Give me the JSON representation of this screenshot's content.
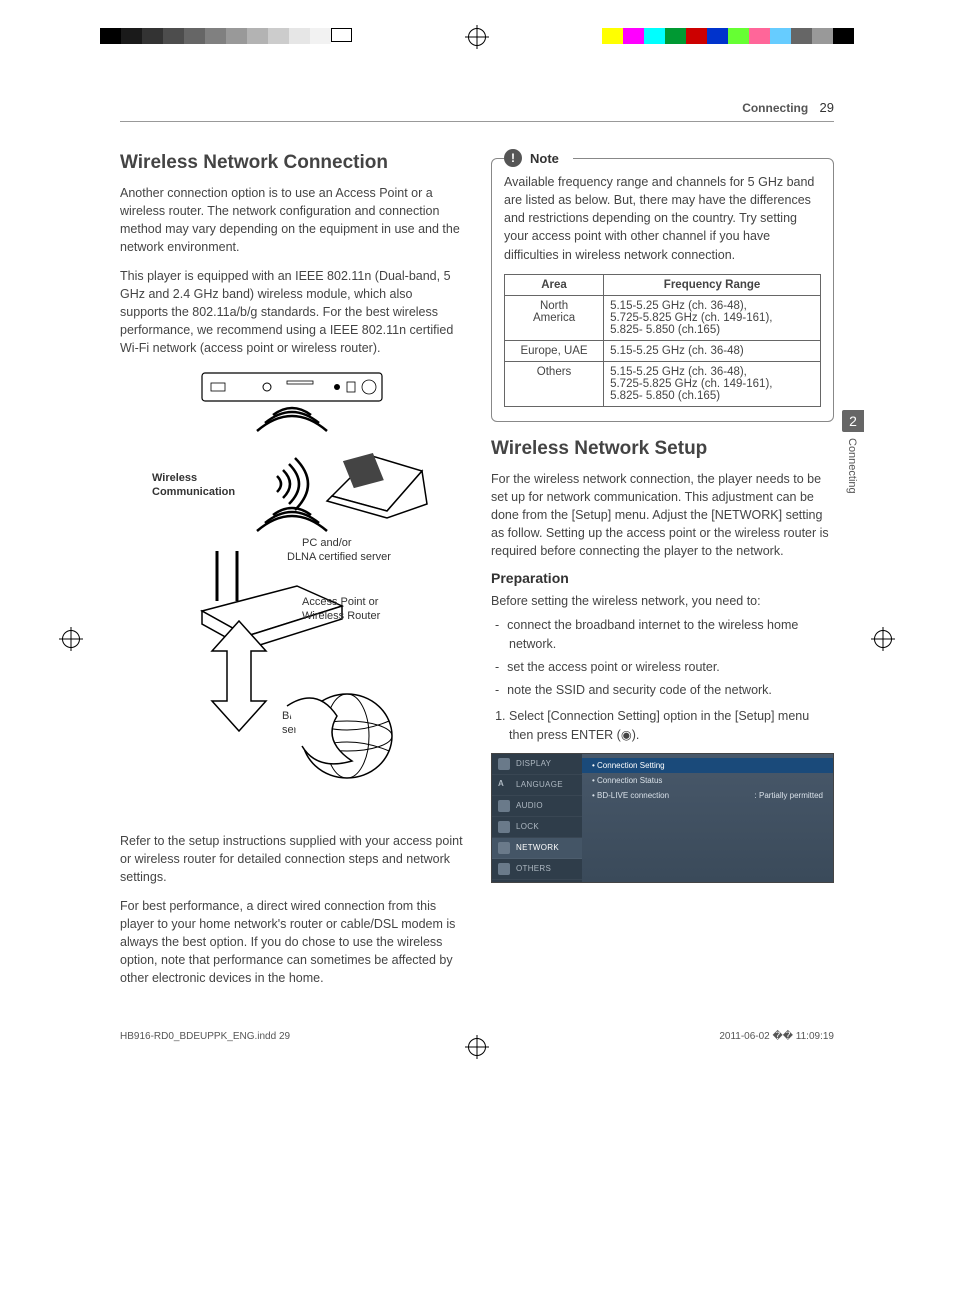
{
  "header": {
    "section": "Connecting",
    "page": "29"
  },
  "side_tab": {
    "num": "2",
    "label": "Connecting"
  },
  "left": {
    "h2": "Wireless Network Connection",
    "p1": "Another connection option is to use an Access Point or a wireless router. The network configuration and connection method may vary depending on the equipment in use and the network environment.",
    "p2": "This player is equipped with an IEEE 802.11n (Dual-band, 5 GHz and 2.4 GHz band) wireless module, which also supports the 802.11a/b/g standards. For the best wireless performance, we recommend using a IEEE 802.11n certified Wi-Fi network (access point or wireless router).",
    "diagram": {
      "wc_label": "Wireless\nCommunication",
      "pc_label": "PC and/or\nDLNA certified server",
      "ap_label": "Access Point or\nWireless Router",
      "bb_label": "Broadband\nservice"
    },
    "p3": "Refer to the setup instructions supplied with your access point or wireless router for detailed connection steps and network settings.",
    "p4": "For best performance, a direct wired connection from this player to your home network's router or cable/DSL modem is always the best option. If you do chose to use the wireless option, note that performance can sometimes be affected by other electronic devices in the home."
  },
  "right": {
    "note": {
      "label": "Note",
      "text": "Available frequency range and channels for 5 GHz band are listed as below. But, there may have the differences and restrictions depending on the country. Try setting your access point with other channel if you have difficulties in wireless network connection.",
      "table": {
        "headers": [
          "Area",
          "Frequency Range"
        ],
        "rows": [
          {
            "area": "North\nAmerica",
            "freq": "5.15-5.25 GHz (ch. 36-48),\n5.725-5.825 GHz (ch. 149-161),\n5.825- 5.850 (ch.165)"
          },
          {
            "area": "Europe, UAE",
            "freq": "5.15-5.25 GHz (ch. 36-48)"
          },
          {
            "area": "Others",
            "freq": "5.15-5.25 GHz (ch. 36-48),\n5.725-5.825 GHz (ch. 149-161),\n5.825- 5.850 (ch.165)"
          }
        ]
      }
    },
    "h2": "Wireless Network Setup",
    "p1": "For the wireless network connection, the player needs to be set up for network communication. This adjustment can be done from the [Setup] menu. Adjust the [NETWORK] setting as follow. Setting up the access point or the wireless router is required before connecting the player to the network.",
    "h3": "Preparation",
    "prep_intro": "Before setting the wireless network, you need to:",
    "prep_list": [
      "connect the broadband internet to the wireless home network.",
      "set the access point or wireless router.",
      "note the SSID and security code of the network."
    ],
    "step1": "Select [Connection Setting] option in the [Setup] menu then press ENTER (◉).",
    "menu": {
      "side": [
        "DISPLAY",
        "LANGUAGE",
        "AUDIO",
        "LOCK",
        "NETWORK",
        "OTHERS"
      ],
      "content": {
        "row1": "Connection Setting",
        "row2_l": "Connection Status",
        "row3_l": "BD-LIVE connection",
        "row3_r": ": Partially permitted"
      }
    }
  },
  "footer": {
    "file": "HB916-RD0_BDEUPPK_ENG.indd   29",
    "ts": "2011-06-02   �� 11:09:19"
  }
}
